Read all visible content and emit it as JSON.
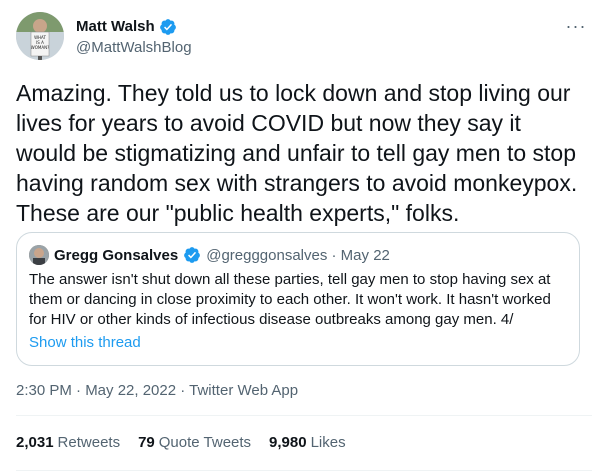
{
  "author": {
    "name": "Matt Walsh",
    "handle": "@MattWalshBlog",
    "avatar_sign_text": "WHAT IS A WOMAN?"
  },
  "tweet": {
    "text": "Amazing. They told us to lock down and stop living our lives for years to avoid COVID but now they say it would be stigmatizing and unfair to tell gay men to stop having random sex with strangers to avoid monkeypox. These are our \"public health experts,\" folks."
  },
  "quoted": {
    "name": "Gregg Gonsalves",
    "handle_date": "@gregggonsalves · May 22",
    "text": "The answer isn't shut down all these parties, tell gay men to stop having sex at them or dancing in close proximity to each other. It won't work. It hasn't worked for HIV or other kinds of infectious disease outbreaks among gay men. 4/",
    "thread_link": "Show this thread"
  },
  "meta": "2:30 PM · May 22, 2022 · Twitter Web App",
  "stats": {
    "retweets_count": "2,031",
    "retweets_label": "Retweets",
    "quotes_count": "79",
    "quotes_label": "Quote Tweets",
    "likes_count": "9,980",
    "likes_label": "Likes"
  },
  "colors": {
    "accent": "#1d9bf0",
    "secondary_text": "#536471",
    "border": "#cfd9de"
  },
  "icons": {
    "verified": "verified-badge-icon",
    "more": "more-horizontal-icon"
  }
}
